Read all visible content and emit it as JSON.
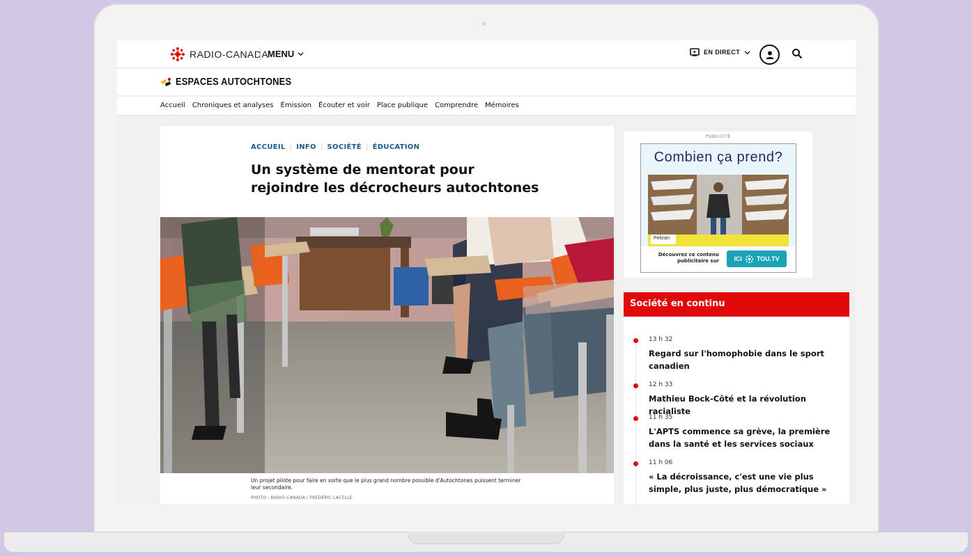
{
  "header": {
    "brand": "RADIO-CANADA",
    "menu_label": "MENU",
    "live_label": "EN DIRECT"
  },
  "section": {
    "title": "ESPACES AUTOCHTONES"
  },
  "nav": {
    "items": [
      "Accueil",
      "Chroniques et analyses",
      "Émission",
      "Écouter et voir",
      "Place publique",
      "Comprendre",
      "Mémoires"
    ]
  },
  "article": {
    "breadcrumb": [
      "ACCUEIL",
      "INFO",
      "SOCIÉTÉ",
      "ÉDUCATION"
    ],
    "headline": "Un système de mentorat pour rejoindre les décrocheurs autochtones",
    "caption": "Un projet pilote pour faire en sorte que le plus grand nombre possible d'Autochtones puissent terminer leur secondaire.",
    "credit": "PHOTO : RADIO-CANADA / FRÉDÉRIC LACELLE"
  },
  "ad": {
    "label": "PUBLICITÉ",
    "title": "Combien ça prend?",
    "brand_tag": "Pelican",
    "disclaimer": "Découvrez ce contenu publicitaire sur",
    "cta_ici": "ICI",
    "cta_tou": "TOU.TV"
  },
  "feed": {
    "heading": "Société en continu",
    "items": [
      {
        "time": "13 h 32",
        "title": "Regard sur l'homophobie dans le sport canadien"
      },
      {
        "time": "12 h 33",
        "title": "Mathieu Bock-Côté et la révolution racialiste"
      },
      {
        "time": "11 h 35",
        "title": "L'APTS commence sa grève, la première dans la santé et les services sociaux"
      },
      {
        "time": "11 h 06",
        "title": "« La décroissance, c'est une vie plus simple, plus juste, plus démocratique »"
      }
    ]
  },
  "colors": {
    "background": "#d3c7e6",
    "accent_red": "#e00a0a",
    "breadcrumb_blue": "#1a5a8a",
    "toutv_teal": "#1aa3b8"
  },
  "icons": [
    "radio-canada-gem-icon",
    "chevron-down-icon",
    "live-tv-icon",
    "user-icon",
    "search-icon",
    "espaces-autochtones-logo-icon"
  ]
}
